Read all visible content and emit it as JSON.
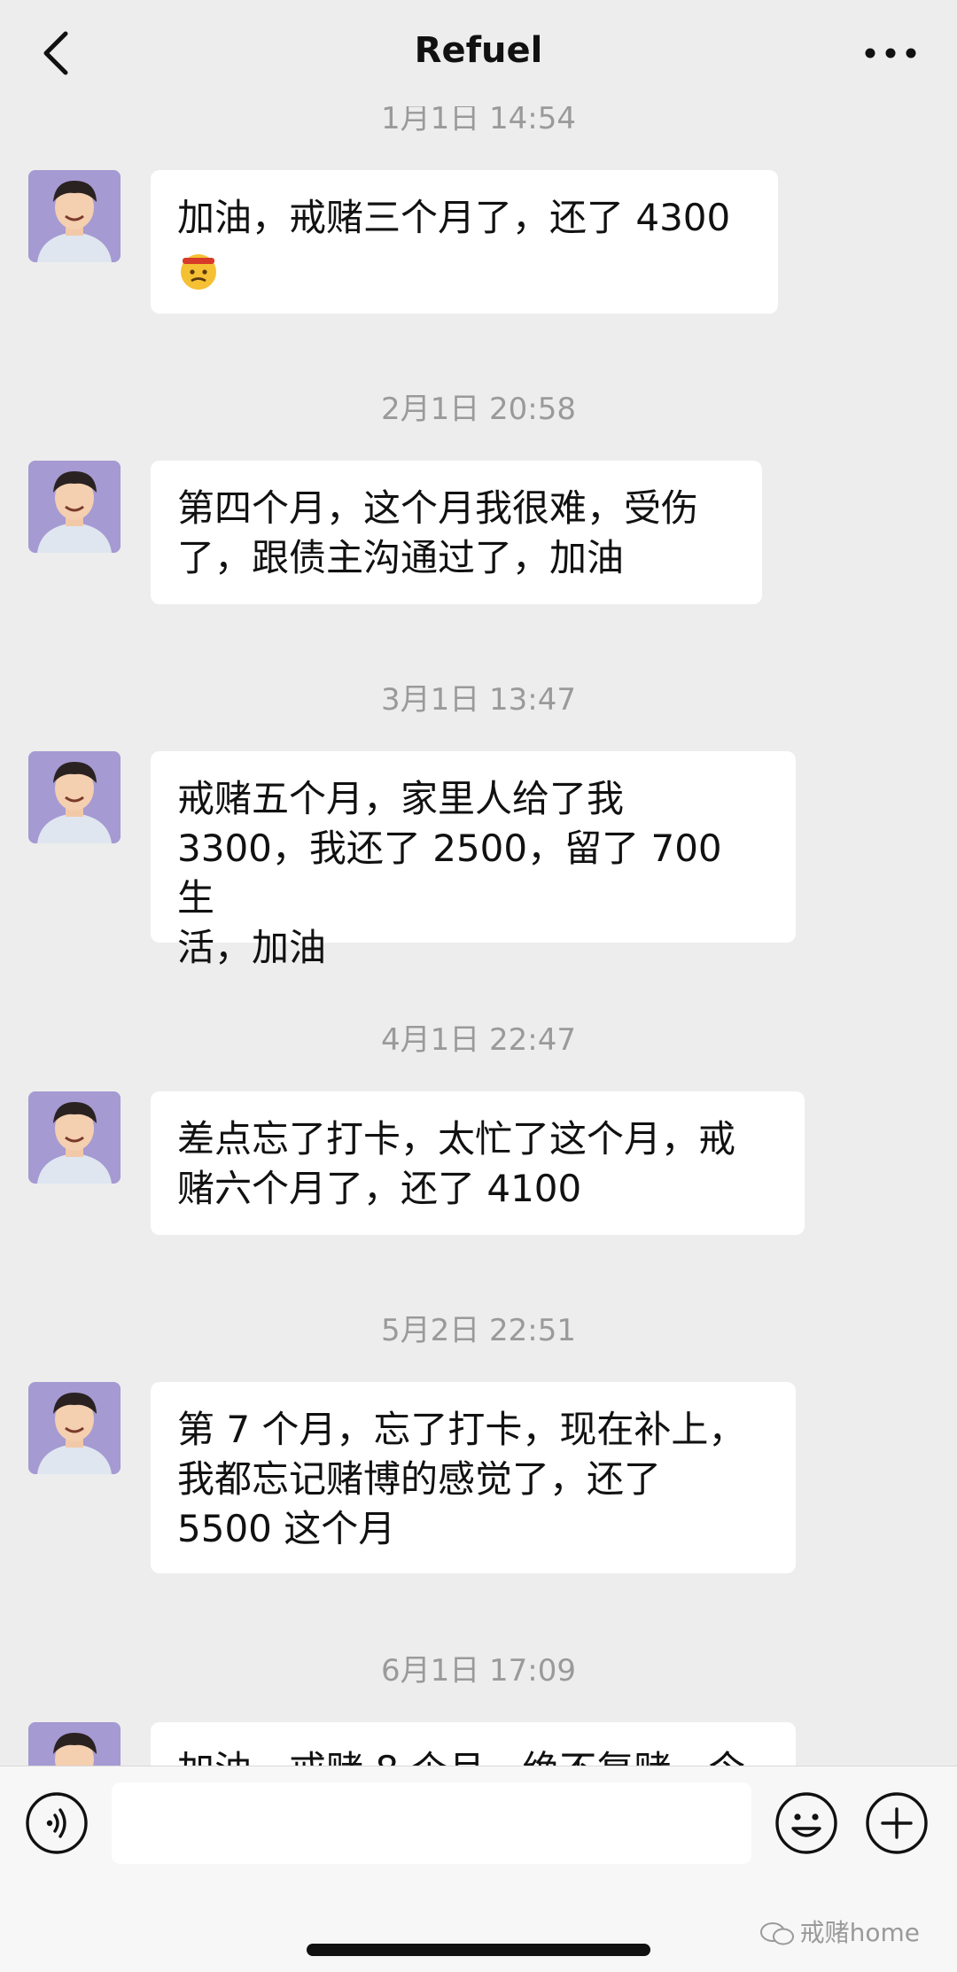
{
  "header": {
    "title": "Refuel"
  },
  "messages": [
    {
      "time": "1月1日 14:54",
      "text": "加油，戒赌三个月了，还了 4300",
      "emoji": "cursing-face"
    },
    {
      "time": "2月1日 20:58",
      "text": "第四个月，这个月我很难，受伤\n了，跟债主沟通过了，加油"
    },
    {
      "time": "3月1日 13:47",
      "text": "戒赌五个月，家里人给了我\n3300，我还了 2500，留了 700 生\n活，加油"
    },
    {
      "time": "4月1日 22:47",
      "text": "差点忘了打卡，太忙了这个月，戒\n赌六个月了，还了 4100"
    },
    {
      "time": "5月2日 22:51",
      "text": "第 7 个月，忘了打卡，现在补上，\n我都忘记赌博的感觉了，还了\n5500 这个月"
    },
    {
      "time": "6月1日 17:09",
      "text": "加油，戒赌 8 个月，绝不复赌，今"
    }
  ],
  "input": {
    "value": "",
    "placeholder": ""
  },
  "watermark": {
    "text": "戒赌home"
  },
  "colors": {
    "background": "#ededed",
    "bubble": "#ffffff",
    "timestamp": "#9a9a9a",
    "avatar_bg": "#a59ad2"
  }
}
